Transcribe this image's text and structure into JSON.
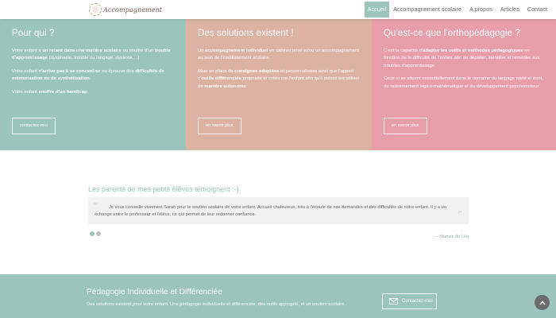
{
  "header": {
    "logo_text": "Accompagnement",
    "nav": [
      "Accueil",
      "Accompagnement scolaire",
      "A propos",
      "Articles",
      "Contact"
    ]
  },
  "col1": {
    "title": "Pour qui ?",
    "p1": {
      "a": "Votre enfant a ",
      "b": "un retard dans une matière scolaire",
      "c": " ou souffre d'un ",
      "d": "trouble d'apprentissage",
      "e": " (dysphasie, trouble du langage, dyslexie,...)"
    },
    "p2": {
      "a": "Votre enfant ",
      "b": "n'arrive pas à se concentrer",
      "c": " ou éprouve des ",
      "d": "difficultés de mémorisation ou de synthétisation",
      "e": "."
    },
    "p3": {
      "a": "Votre enfant ",
      "b": "souffre d'un handicap",
      "c": "."
    },
    "button": "contactez-moi"
  },
  "col2": {
    "title": "Des solutions existent !",
    "p1": {
      "a": "Un ",
      "b": "accompagnement individuel",
      "c": " en cabinet privé et/ou un accompagnement au sein de l'établissement scolaire."
    },
    "p2": {
      "a": "Mise en place de ",
      "b": "consignes adaptées",
      "c": " et personnalisées ainsi que l'apport d'",
      "d": "outils différenciés",
      "e": " proposés et créés par l'enfant afin qu'il puisse les utiliser de ",
      "f": "manière autonome",
      "g": "."
    },
    "button": "en savoir plus"
  },
  "col3": {
    "title": "Qu'est-ce que l'orthopédagogie ?",
    "p1": {
      "a": "C'est la capacité d'",
      "b": "adapter les outils et méthodes pédagogiques",
      "c": " en fonction de la difficulté de l'enfant afin de dépister, identifier et remédier aux troubles d'apprentissage."
    },
    "p2": "Ceux-ci se situent essentiellement dans le domaine du langage parlé et écrit, du raisonnement logico-mathématique et du développement psychomoteur.",
    "button": "en savoir plus"
  },
  "testimonial": {
    "title": "Les parents de mes petits élèves témoignent :-)",
    "text": "Je vous conseille vivement Sarah pour le soutien scolaire de votre enfant. Accueil chaleureux, très à l'écoute de nos demandes et des difficultés de notre enfant. Il y a un échange entre le professeur et l'élève, ce qui permet de leur redonner confiance.",
    "author": "— Maman de Léa",
    "open_quote": "“",
    "close_quote": "”"
  },
  "band": {
    "title": "Pédagogie Individuelle et Différenciée",
    "subtitle": "Des solutions existent pour votre enfant. Une pédagogie individuelle et différenciée, des outils approprié, et un soutien scolaire.",
    "button": "Contactez-moi"
  },
  "icons": {
    "mail": "envelope-icon",
    "scroll_top": "chevron-up-icon"
  },
  "colors": {
    "teal": "#9bc5bb",
    "peach": "#dcb3a3",
    "pink": "#e79ea8"
  }
}
